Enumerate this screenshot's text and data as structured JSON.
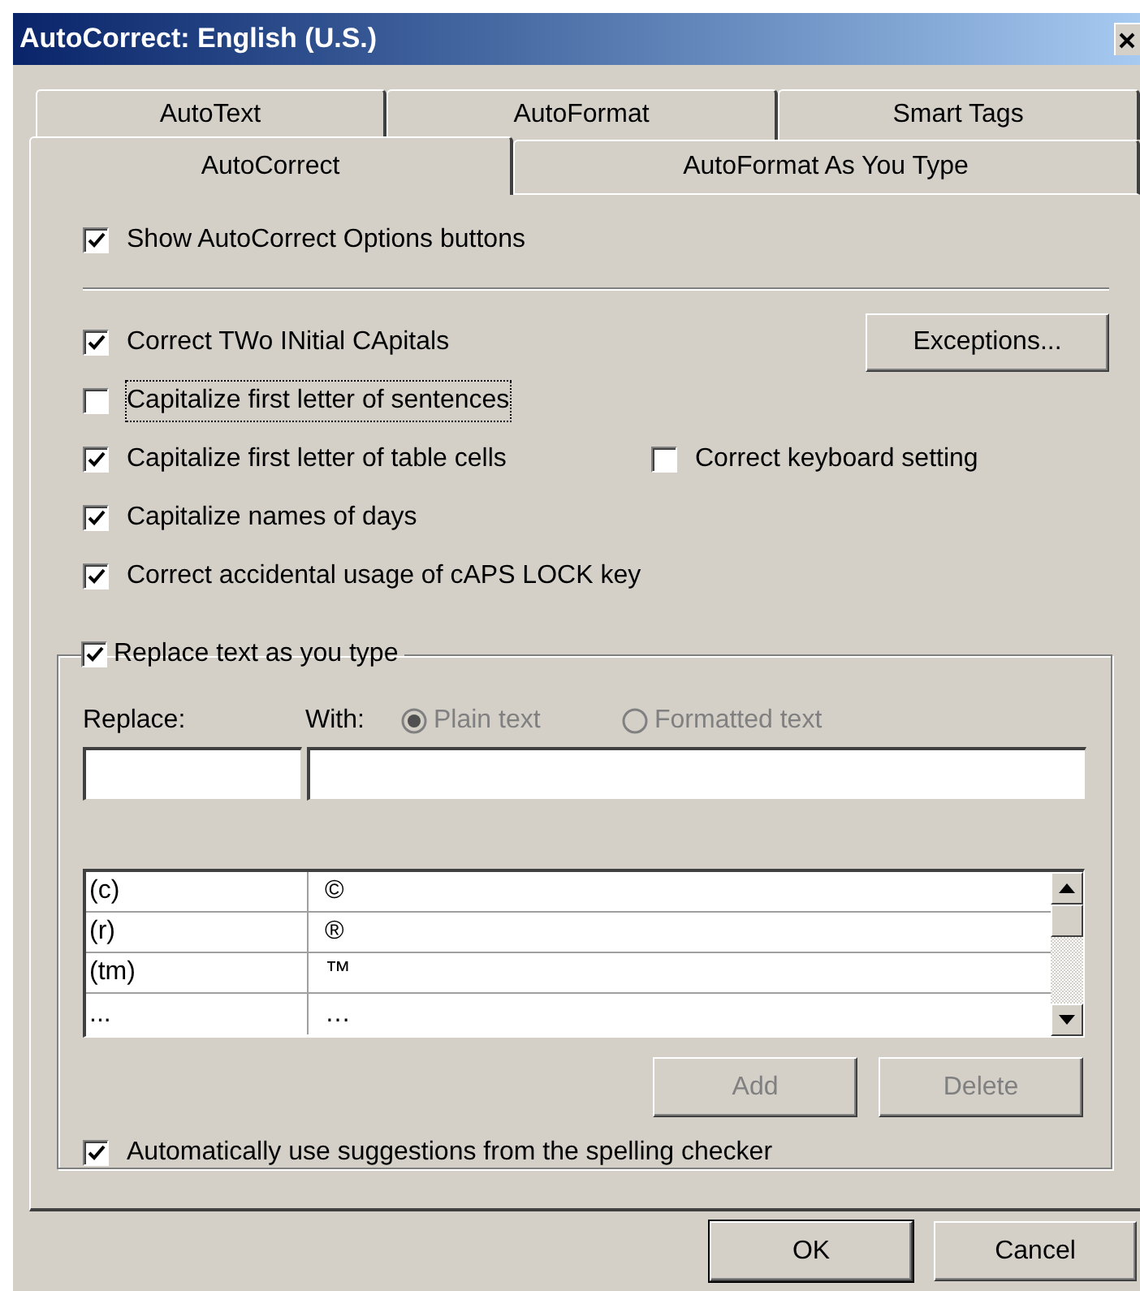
{
  "window": {
    "title": "AutoCorrect: English (U.S.)"
  },
  "tabs_back": [
    {
      "label": "AutoText",
      "selected": false
    },
    {
      "label": "AutoFormat",
      "selected": false
    },
    {
      "label": "Smart Tags",
      "selected": false
    }
  ],
  "tabs_front": [
    {
      "label": "AutoCorrect",
      "selected": true
    },
    {
      "label": "AutoFormat As You Type",
      "selected": false
    }
  ],
  "show_options_buttons": {
    "label": "Show AutoCorrect Options buttons",
    "checked": true
  },
  "exceptions_button": {
    "label": "Exceptions..."
  },
  "options": [
    {
      "label": "Correct TWo INitial CApitals",
      "checked": true,
      "focused": false
    },
    {
      "label": "Capitalize first letter of sentences",
      "checked": false,
      "focused": true
    },
    {
      "label": "Capitalize first letter of table cells",
      "checked": true,
      "focused": false
    },
    {
      "label": "Capitalize names of days",
      "checked": true,
      "focused": false
    },
    {
      "label": "Correct accidental usage of cAPS LOCK key",
      "checked": true,
      "focused": false
    }
  ],
  "keyboard_setting": {
    "label": "Correct keyboard setting",
    "checked": false
  },
  "replace_group": {
    "label": "Replace text as you type",
    "checked": true,
    "replace_label": "Replace:",
    "with_label": "With:",
    "format_options": [
      {
        "label": "Plain text",
        "selected": true,
        "disabled": true
      },
      {
        "label": "Formatted text",
        "selected": false,
        "disabled": true
      }
    ],
    "entries": [
      {
        "replace": "(c)",
        "with": "©"
      },
      {
        "replace": "(r)",
        "with": "®"
      },
      {
        "replace": "(tm)",
        "with": "™"
      },
      {
        "replace": "...",
        "with": "…"
      }
    ],
    "buttons": [
      {
        "label": "Add",
        "disabled": true
      },
      {
        "label": "Delete",
        "disabled": true
      }
    ],
    "spelling": {
      "label": "Automatically use suggestions from the spelling checker",
      "checked": true
    }
  },
  "buttons": [
    {
      "label": "OK",
      "default": true
    },
    {
      "label": "Cancel",
      "default": false
    }
  ]
}
